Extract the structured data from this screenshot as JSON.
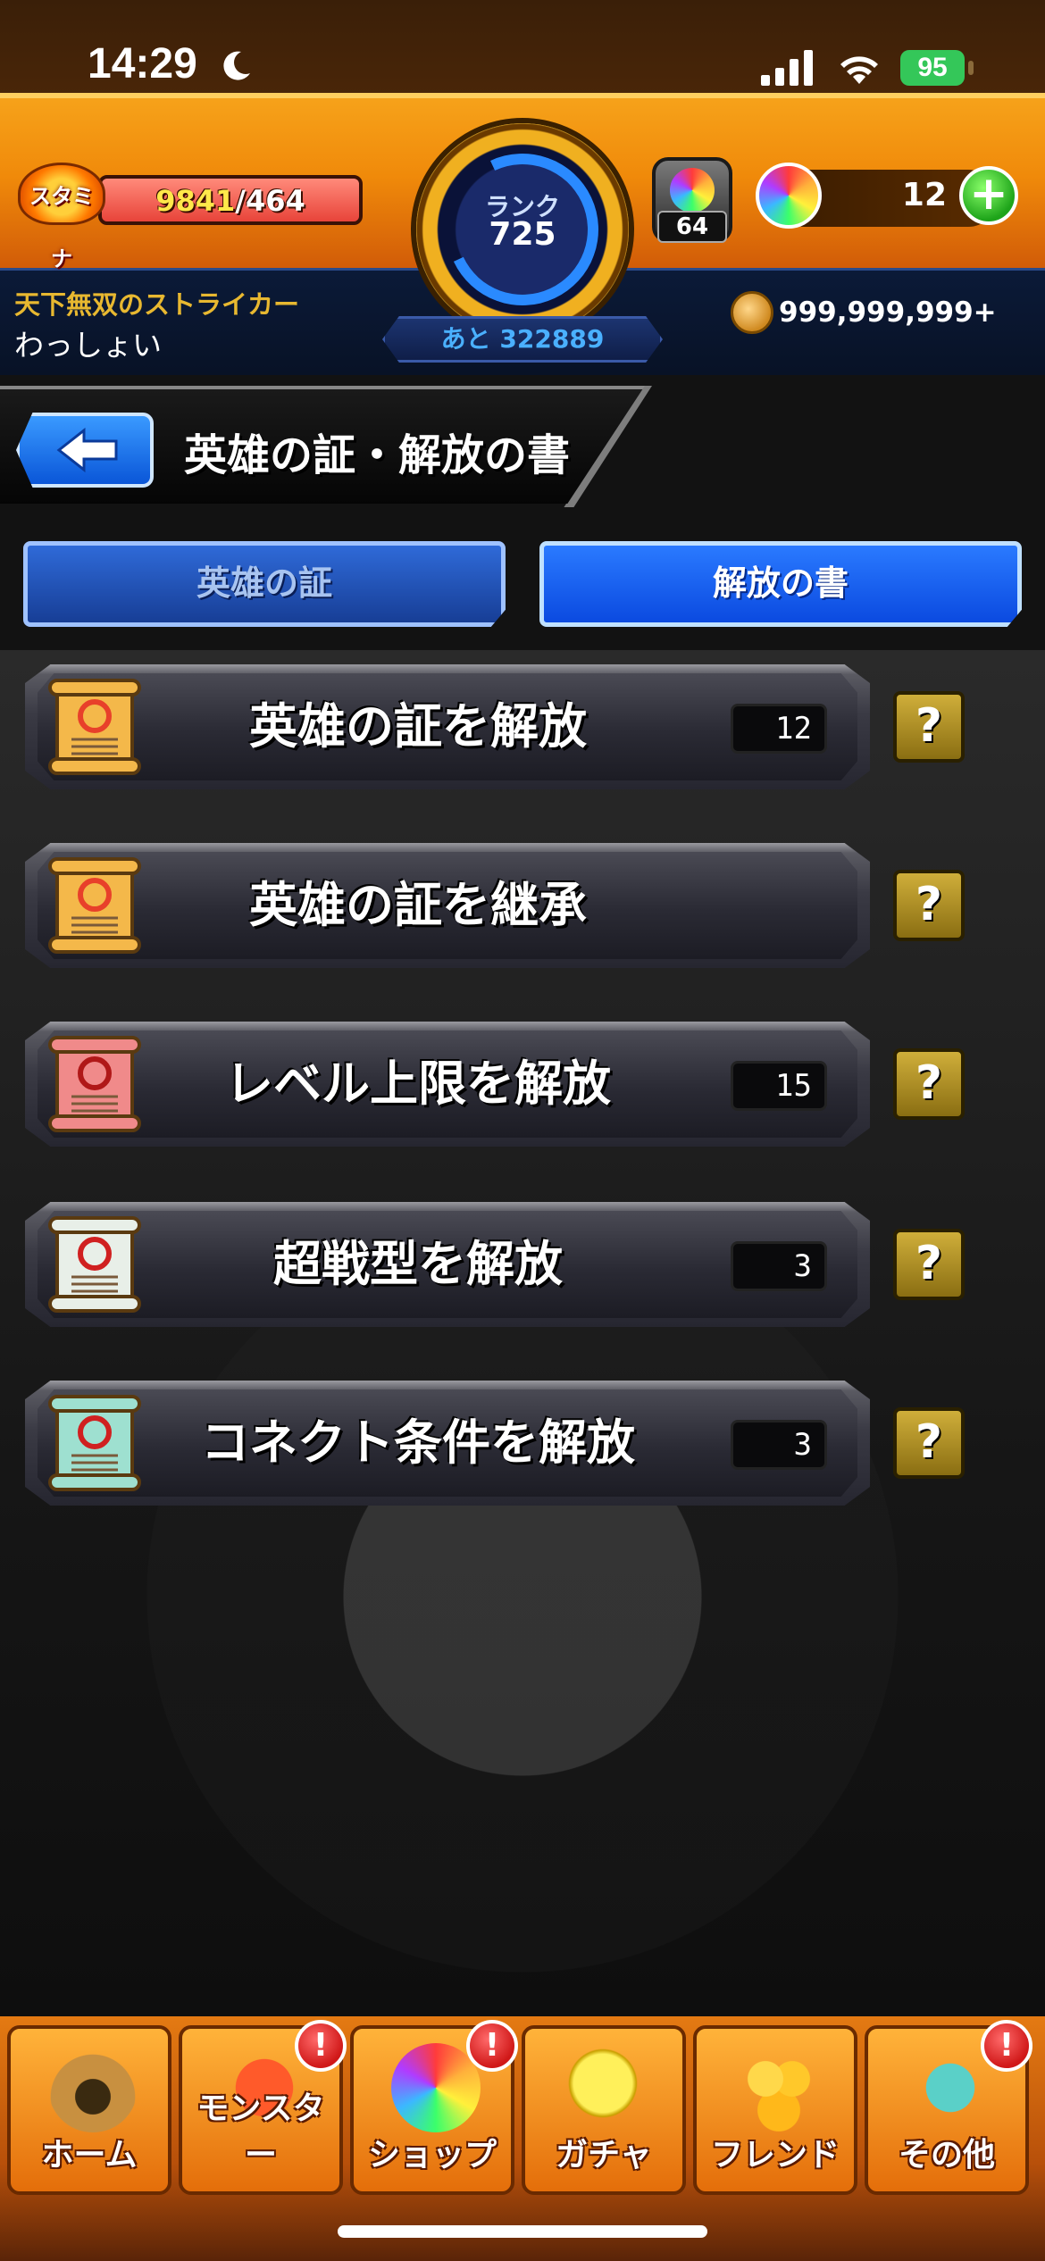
{
  "status_bar": {
    "time": "14:29",
    "battery": "95"
  },
  "header": {
    "stamina_label": "スタミナ",
    "stamina_current": "9841",
    "stamina_separator": "/",
    "stamina_max": "464",
    "stamina_fill_percent": 100,
    "rank_label": "ランク",
    "rank_value": "725",
    "rank_next": "あと 322889",
    "player_title": "天下無双のストライカー",
    "player_name": "わっしょい",
    "lucky_count": "64",
    "orb_count": "12",
    "orb_plus": "+",
    "gold": "999,999,999+"
  },
  "page": {
    "title": "英雄の証・解放の書"
  },
  "tabs": [
    {
      "label": "英雄の証",
      "active": false
    },
    {
      "label": "解放の書",
      "active": true
    }
  ],
  "menu": [
    {
      "label": "英雄の証を解放",
      "count": "12",
      "scroll_color": "#f4b84a",
      "emblem_color": "#e8402a",
      "icon": "hero-proof-scroll-icon"
    },
    {
      "label": "英雄の証を継承",
      "count": null,
      "scroll_color": "#f4b84a",
      "emblem_color": "#e8402a",
      "icon": "inherit-scroll-icon"
    },
    {
      "label": "レベル上限を解放",
      "count": "15",
      "scroll_color": "#f08a8a",
      "emblem_color": "#b01818",
      "icon": "level-cap-scroll-icon"
    },
    {
      "label": "超戦型を解放",
      "count": "3",
      "scroll_color": "#e8efe8",
      "emblem_color": "#d02020",
      "icon": "super-battle-scroll-icon"
    },
    {
      "label": "コネクト条件を解放",
      "count": "3",
      "scroll_color": "#9ee0d0",
      "emblem_color": "#d02020",
      "icon": "connect-scroll-icon"
    }
  ],
  "help_label": "?",
  "nav": [
    {
      "label": "ホーム",
      "icon": "home-icon",
      "alert": false
    },
    {
      "label": "モンスター",
      "icon": "monster-icon",
      "alert": true
    },
    {
      "label": "ショップ",
      "icon": "shop-orb-icon",
      "alert": true
    },
    {
      "label": "ガチャ",
      "icon": "gacha-egg-icon",
      "alert": false
    },
    {
      "label": "フレンド",
      "icon": "friend-icon",
      "alert": false
    },
    {
      "label": "その他",
      "icon": "other-icon",
      "alert": true
    }
  ],
  "alert_symbol": "!"
}
